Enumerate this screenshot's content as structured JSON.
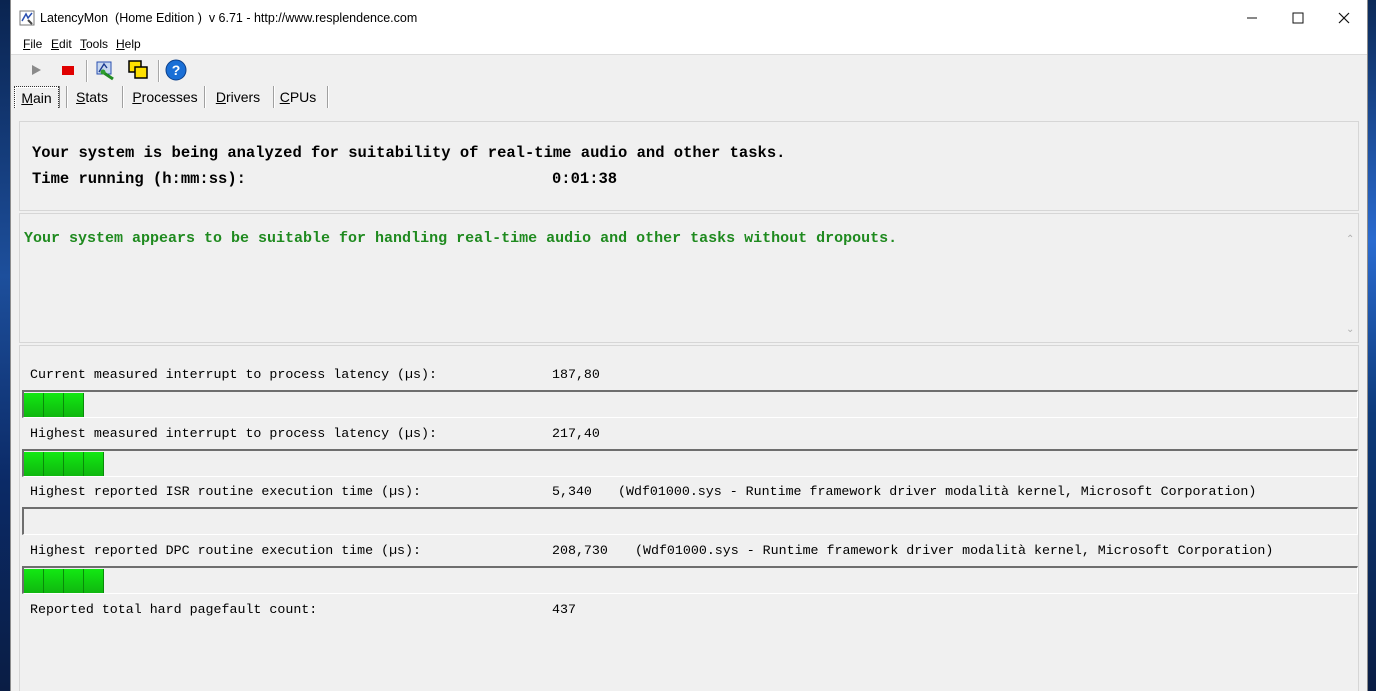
{
  "window": {
    "title": "LatencyMon  (Home Edition )  v 6.71 - http://www.resplendence.com",
    "controls": [
      "minimize-icon",
      "maximize-icon",
      "close-icon"
    ]
  },
  "menu": [
    {
      "label": "File",
      "accel": "F",
      "rest": "ile"
    },
    {
      "label": "Edit",
      "accel": "E",
      "rest": "dit"
    },
    {
      "label": "Tools",
      "accel": "T",
      "rest": "ools"
    },
    {
      "label": "Help",
      "accel": "H",
      "rest": "elp"
    }
  ],
  "toolbar": {
    "icons": [
      "play-icon",
      "stop-icon",
      "driver-tool-icon",
      "windows-icon",
      "help-icon"
    ],
    "colors": {
      "stop": "#e00000",
      "help": "#1a6fd6",
      "play": "#8a8a8a"
    }
  },
  "tabs": [
    {
      "label": "Main",
      "accel": "M",
      "rest": "ain",
      "active": true
    },
    {
      "label": "Stats",
      "accel": "S",
      "rest": "tats",
      "active": false
    },
    {
      "label": "Processes",
      "accel": "P",
      "rest": "rocesses",
      "active": false
    },
    {
      "label": "Drivers",
      "accel": "D",
      "rest": "rivers",
      "active": false
    },
    {
      "label": "CPUs",
      "accel": "C",
      "rest": "PUs",
      "active": false
    }
  ],
  "status": {
    "analysis_text": "Your system is being analyzed for suitability of real-time audio and other tasks.",
    "time_label": "Time running (h:mm:ss):",
    "time_value": "0:01:38"
  },
  "verdict": {
    "text": "Your system appears to be suitable for handling real-time audio and other tasks without dropouts.",
    "color": "#1f8a1f"
  },
  "metrics": [
    {
      "label": "Current measured interrupt to process latency (µs):",
      "value": "187,80",
      "detail": "",
      "segments": 3
    },
    {
      "label": "Highest measured interrupt to process latency (µs):",
      "value": "217,40",
      "detail": "",
      "segments": 4
    },
    {
      "label": "Highest reported ISR routine execution time (µs):",
      "value": "5,340",
      "detail": "(Wdf01000.sys - Runtime framework driver modalità kernel, Microsoft Corporation)",
      "segments": 0
    },
    {
      "label": "Highest reported DPC routine execution time (µs):",
      "value": "208,730",
      "detail": "(Wdf01000.sys - Runtime framework driver modalità kernel, Microsoft Corporation)",
      "segments": 4
    },
    {
      "label": "Reported total hard pagefault count:",
      "value": "437",
      "detail": "",
      "segments": null
    }
  ],
  "bar_color": "#12e812"
}
